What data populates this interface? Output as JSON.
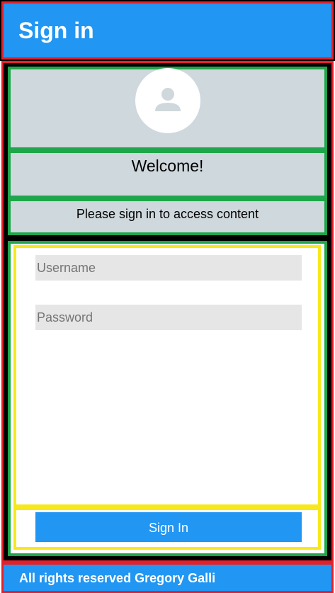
{
  "header": {
    "title": "Sign in"
  },
  "profile": {
    "avatar_icon": "user-icon",
    "welcome": "Welcome!",
    "subtitle": "Please sign in to access content"
  },
  "form": {
    "username": {
      "placeholder": "Username",
      "value": ""
    },
    "password": {
      "placeholder": "Password",
      "value": ""
    },
    "submit_label": "Sign In"
  },
  "footer": {
    "text": "All rights reserved Gregory Galli"
  },
  "colors": {
    "primary": "#2196f3",
    "outline_red": "#e5202a",
    "outline_green": "#1fa64a",
    "outline_yellow": "#f7e81c",
    "panel_gray": "#cfd8dc",
    "input_bg": "#e6e6e6"
  }
}
